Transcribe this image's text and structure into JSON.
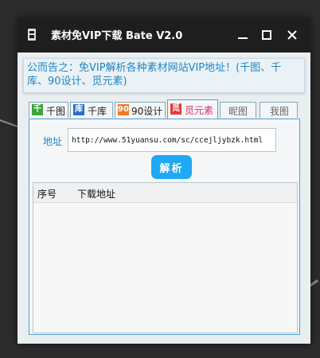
{
  "window": {
    "title": "素材免VIP下载 Bate V2.0"
  },
  "notice": {
    "text": "公而告之：免VIP解析各种素材网站VIP地址！(千图、千库、90设计、觅元素)"
  },
  "tabs": [
    {
      "icon_text": "千",
      "icon_color": "#3aa63a",
      "label": "千图",
      "active": false
    },
    {
      "icon_text": "库",
      "icon_color": "#2a6fc9",
      "label": "千库",
      "active": false
    },
    {
      "icon_text": "90",
      "icon_color": "#f07a22",
      "label": "90设计",
      "active": false
    },
    {
      "icon_text": "觅",
      "icon_color": "#e63b3b",
      "label": "觅元素",
      "active": true
    },
    {
      "icon_text": "",
      "icon_color": "",
      "label": "昵图",
      "active": false
    },
    {
      "icon_text": "",
      "icon_color": "",
      "label": "我图",
      "active": false
    }
  ],
  "form": {
    "address_label": "地址",
    "address_value": "http://www.51yuansu.com/sc/ccejljybzk.html",
    "parse_button": "解析"
  },
  "list": {
    "columns": [
      "序号",
      "下载地址"
    ]
  },
  "colors": {
    "accent": "#1f86c6",
    "button": "#1fa8f3",
    "titlebar": "#1e1e1e"
  }
}
